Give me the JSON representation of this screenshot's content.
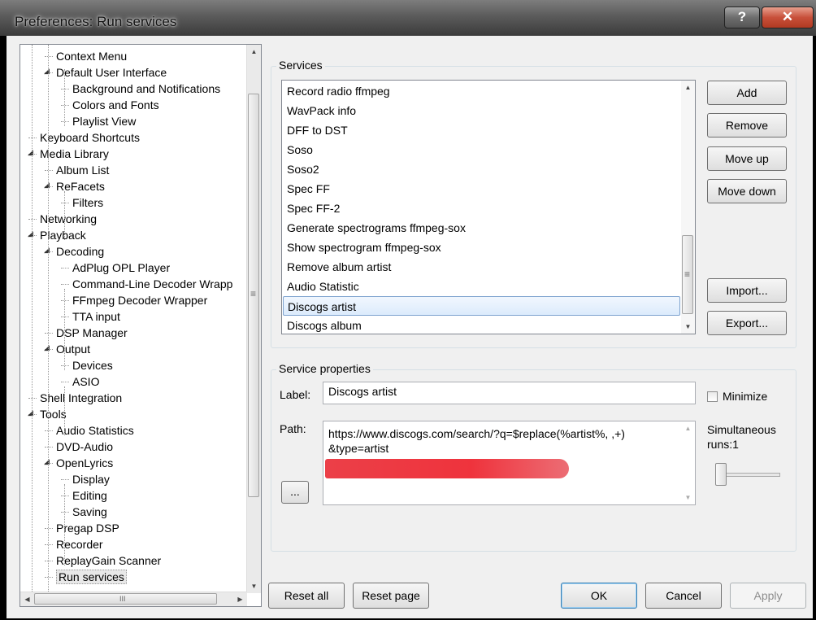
{
  "window": {
    "title": "Preferences: Run services",
    "help_label": "?",
    "close_label": "✕"
  },
  "tree": {
    "items": [
      {
        "label": "Context Menu",
        "level": 2,
        "arrow": ""
      },
      {
        "label": "Default User Interface",
        "level": 2,
        "arrow": "◢"
      },
      {
        "label": "Background and Notifications",
        "level": 3,
        "arrow": ""
      },
      {
        "label": "Colors and Fonts",
        "level": 3,
        "arrow": ""
      },
      {
        "label": "Playlist View",
        "level": 3,
        "arrow": ""
      },
      {
        "label": "Keyboard Shortcuts",
        "level": 1,
        "arrow": ""
      },
      {
        "label": "Media Library",
        "level": 1,
        "arrow": "◢"
      },
      {
        "label": "Album List",
        "level": 2,
        "arrow": ""
      },
      {
        "label": "ReFacets",
        "level": 2,
        "arrow": "◢"
      },
      {
        "label": "Filters",
        "level": 3,
        "arrow": ""
      },
      {
        "label": "Networking",
        "level": 1,
        "arrow": ""
      },
      {
        "label": "Playback",
        "level": 1,
        "arrow": "◢"
      },
      {
        "label": "Decoding",
        "level": 2,
        "arrow": "◢"
      },
      {
        "label": "AdPlug OPL Player",
        "level": 3,
        "arrow": ""
      },
      {
        "label": "Command-Line Decoder Wrapp",
        "level": 3,
        "arrow": ""
      },
      {
        "label": "FFmpeg Decoder Wrapper",
        "level": 3,
        "arrow": ""
      },
      {
        "label": "TTA input",
        "level": 3,
        "arrow": ""
      },
      {
        "label": "DSP Manager",
        "level": 2,
        "arrow": ""
      },
      {
        "label": "Output",
        "level": 2,
        "arrow": "◢"
      },
      {
        "label": "Devices",
        "level": 3,
        "arrow": ""
      },
      {
        "label": "ASIO",
        "level": 3,
        "arrow": ""
      },
      {
        "label": "Shell Integration",
        "level": 1,
        "arrow": ""
      },
      {
        "label": "Tools",
        "level": 1,
        "arrow": "◢"
      },
      {
        "label": "Audio Statistics",
        "level": 2,
        "arrow": ""
      },
      {
        "label": "DVD-Audio",
        "level": 2,
        "arrow": ""
      },
      {
        "label": "OpenLyrics",
        "level": 2,
        "arrow": "◢"
      },
      {
        "label": "Display",
        "level": 3,
        "arrow": ""
      },
      {
        "label": "Editing",
        "level": 3,
        "arrow": ""
      },
      {
        "label": "Saving",
        "level": 3,
        "arrow": ""
      },
      {
        "label": "Pregap DSP",
        "level": 2,
        "arrow": ""
      },
      {
        "label": "Recorder",
        "level": 2,
        "arrow": ""
      },
      {
        "label": "ReplayGain Scanner",
        "level": 2,
        "arrow": ""
      },
      {
        "label": "Run services",
        "level": 2,
        "arrow": "",
        "selected": true
      }
    ],
    "scroll_up": "▲",
    "scroll_down": "▼",
    "scroll_left": "◀",
    "scroll_right": "▶",
    "grip": "≡",
    "hgrip": "III"
  },
  "services": {
    "group_title": "Services",
    "items": [
      "Record radio ffmpeg",
      "WavPack info",
      "DFF to DST",
      "Soso",
      "Soso2",
      "Spec FF",
      "Spec FF-2",
      "Generate spectrograms ffmpeg-sox",
      "Show spectrogram ffmpeg-sox",
      "Remove album artist",
      "Audio Statistic",
      "Discogs artist",
      "Discogs album"
    ],
    "selected_index": 11,
    "buttons": {
      "add": "Add",
      "remove": "Remove",
      "move_up": "Move up",
      "move_down": "Move down",
      "import": "Import...",
      "export": "Export..."
    }
  },
  "properties": {
    "group_title": "Service properties",
    "label_caption": "Label:",
    "label_value": "Discogs artist",
    "minimize_label": "Minimize",
    "minimize_checked": false,
    "path_caption": "Path:",
    "path_line1": "https://www.discogs.com/search/?q=$replace(%artist%, ,+)",
    "path_line2": "&type=artist",
    "browse_label": "...",
    "simultaneous_line1": "Simultaneous",
    "simultaneous_line2": "runs:1",
    "runs_value": 1
  },
  "footer": {
    "reset_all": "Reset all",
    "reset_page": "Reset page",
    "ok": "OK",
    "cancel": "Cancel",
    "apply": "Apply"
  }
}
